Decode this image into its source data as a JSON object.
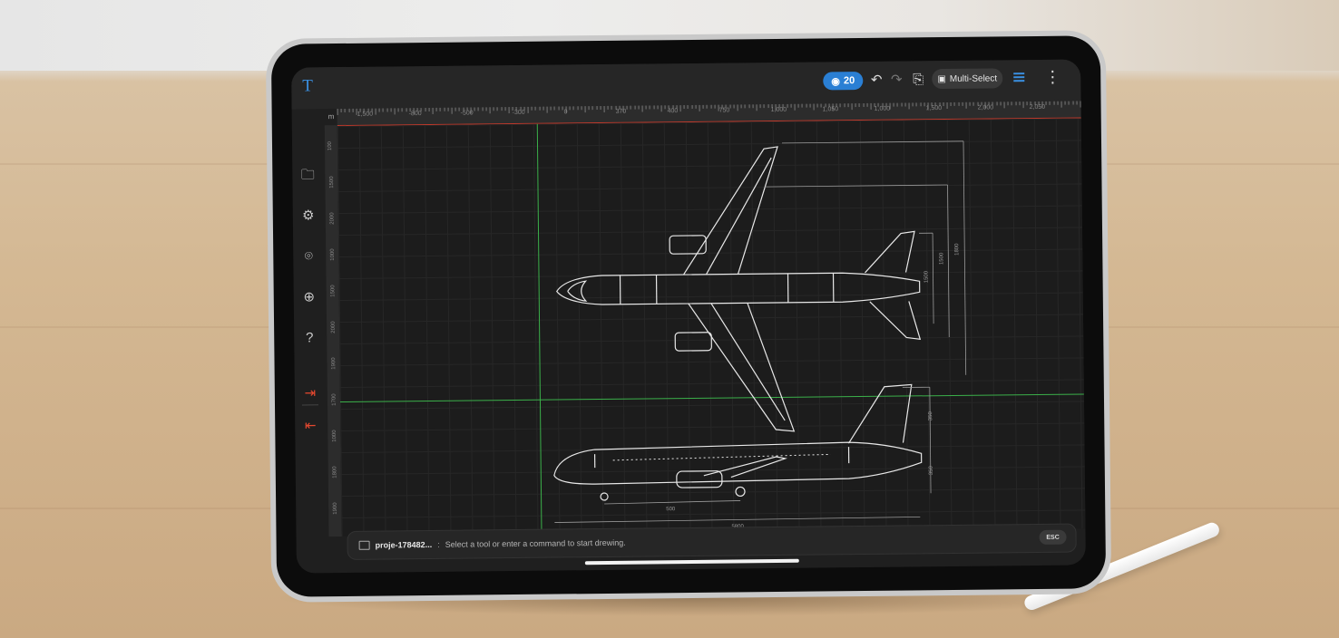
{
  "app": {
    "logo": "T"
  },
  "toolbar": {
    "layer_count": "20",
    "undo_icon": "undo-icon",
    "redo_icon": "redo-icon",
    "preview_icon": "page-search-icon",
    "multi_select_label": "Multi-Select",
    "list_icon": "list-icon",
    "more_icon": "more-vertical-icon",
    "accent_color": "#2a7fd4"
  },
  "ruler": {
    "unit": "m",
    "h_labels": [
      "1,500",
      "-800",
      "-500",
      "-300",
      "0",
      "370",
      "400",
      "750",
      "1,000",
      "1,050",
      "1,000",
      "1,500",
      "2,000",
      "2,050",
      "2,000"
    ],
    "v_labels": [
      "100",
      "1500",
      "2000",
      "1000",
      "1500",
      "2000",
      "1900",
      "1700",
      "1000",
      "1800",
      "1900"
    ]
  },
  "sidebar": {
    "items": [
      {
        "name": "folder-icon"
      },
      {
        "name": "gear-icon"
      },
      {
        "name": "scan-icon"
      },
      {
        "name": "zoom-icon"
      },
      {
        "name": "help-icon"
      },
      {
        "name": "logout-icon"
      },
      {
        "name": "login-icon"
      }
    ]
  },
  "drawing": {
    "dimension_labels": [
      "1800",
      "1500",
      "1500",
      "500",
      "5800",
      "350",
      "350"
    ]
  },
  "fabs": {
    "tools_icon": "tools-icon",
    "draw_icon": "pen-edit-icon"
  },
  "command": {
    "file": "proje-178482...",
    "separator": ":",
    "prompt": "Select a tool or enter a command to start drewing.",
    "esc_label": "ESC"
  },
  "colors": {
    "guide": "#3bb04a",
    "ruler_accent": "#c0392b",
    "danger": "#e5482f"
  }
}
